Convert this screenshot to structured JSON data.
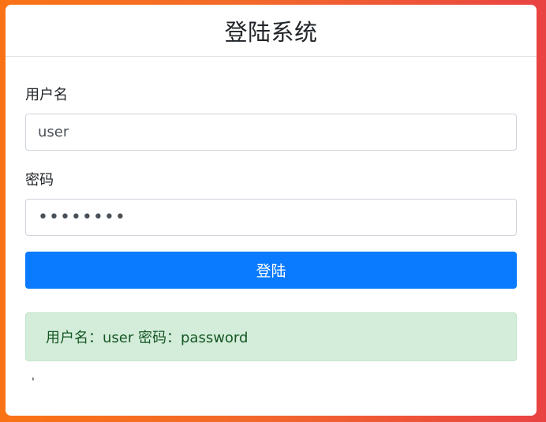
{
  "card": {
    "title": "登陆系统"
  },
  "form": {
    "username_label": "用户名",
    "username_value": "user",
    "password_label": "密码",
    "password_masked": "••••••••",
    "login_button": "登陆"
  },
  "alert": {
    "text": "用户名：user 密码：password"
  },
  "footer_mark": "'"
}
